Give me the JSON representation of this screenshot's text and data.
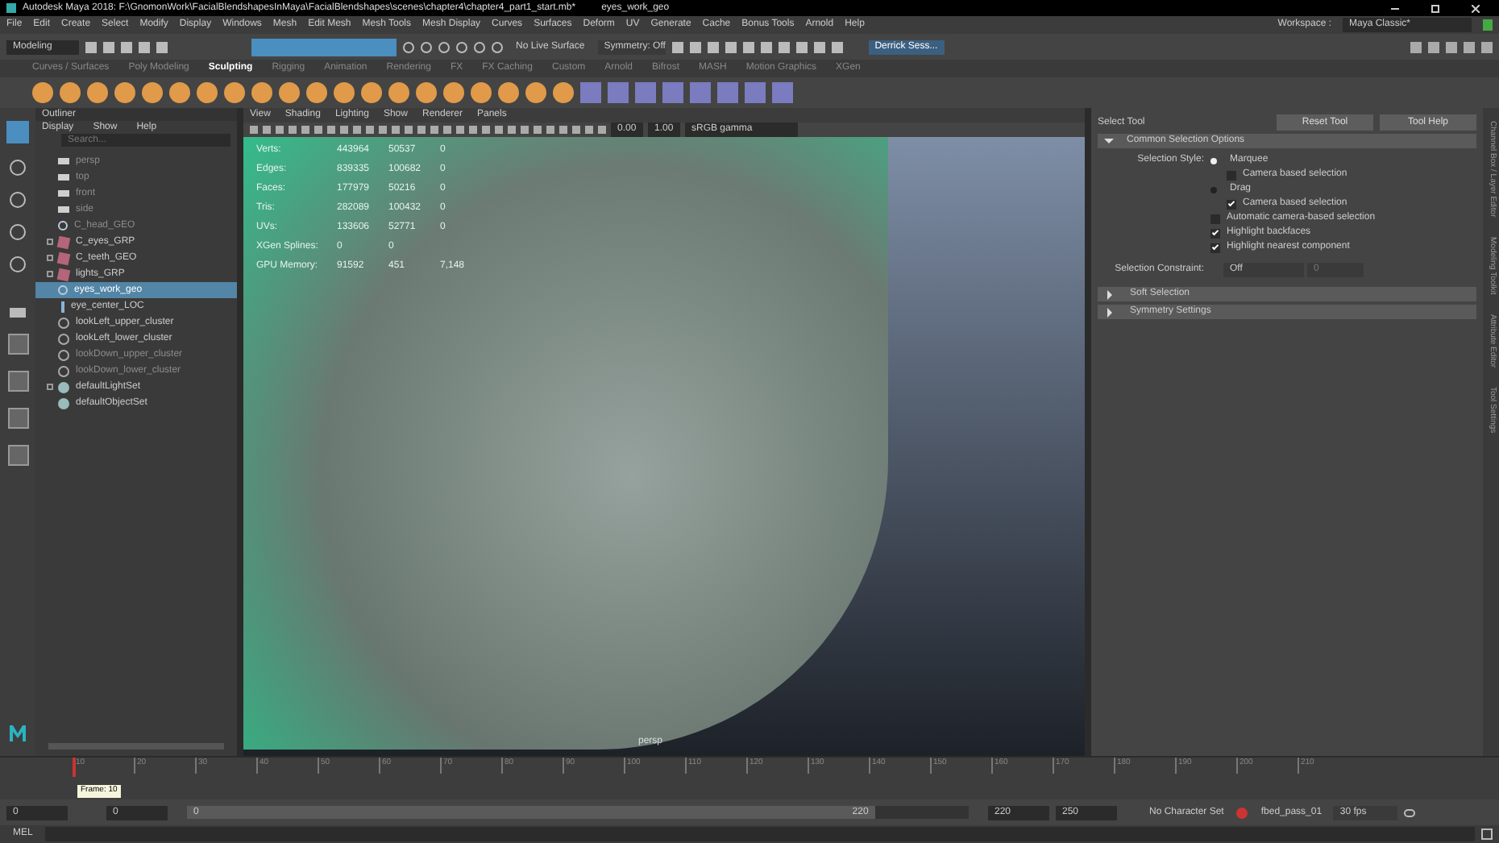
{
  "window": {
    "title": "Autodesk Maya 2018: F:\\GnomonWork\\FacialBlendshapesInMaya\\FacialBlendshapes\\scenes\\chapter4\\chapter4_part1_start.mb*",
    "object": "eyes_work_geo"
  },
  "menu_bar": [
    "File",
    "Edit",
    "Create",
    "Select",
    "Modify",
    "Display",
    "Windows",
    "Mesh",
    "Edit Mesh",
    "Mesh Tools",
    "Mesh Display",
    "Curves",
    "Surfaces",
    "Deform",
    "UV",
    "Generate",
    "Cache",
    "Bonus Tools",
    "Arnold",
    "Help"
  ],
  "status_line": {
    "mode": "Modeling",
    "live_surface": "No Live Surface",
    "symmetry": "Symmetry: Off",
    "user": "Derrick Sess...",
    "workspace_label": "Workspace :",
    "workspace": "Maya Classic*"
  },
  "shelf": {
    "tabs": [
      {
        "label": "Curves / Surfaces",
        "selected": false
      },
      {
        "label": "Poly Modeling",
        "selected": false
      },
      {
        "label": "Sculpting",
        "selected": true
      },
      {
        "label": "Rigging",
        "selected": false
      },
      {
        "label": "Animation",
        "selected": false
      },
      {
        "label": "Rendering",
        "selected": false
      },
      {
        "label": "FX",
        "selected": false
      },
      {
        "label": "FX Caching",
        "selected": false
      },
      {
        "label": "Custom",
        "selected": false
      },
      {
        "label": "Arnold",
        "selected": false
      },
      {
        "label": "Bifrost",
        "selected": false
      },
      {
        "label": "MASH",
        "selected": false
      },
      {
        "label": "Motion Graphics",
        "selected": false
      },
      {
        "label": "XGen",
        "selected": false
      }
    ]
  },
  "outliner": {
    "title": "Outliner",
    "menu": [
      "Display",
      "Show",
      "Help"
    ],
    "search": {
      "placeholder": "Search..."
    },
    "items": [
      {
        "label": "persp",
        "kind": "camera",
        "expandable": false,
        "dimmed": true,
        "selected": false
      },
      {
        "label": "top",
        "kind": "camera",
        "expandable": false,
        "dimmed": true,
        "selected": false
      },
      {
        "label": "front",
        "kind": "camera",
        "expandable": false,
        "dimmed": true,
        "selected": false
      },
      {
        "label": "side",
        "kind": "camera",
        "expandable": false,
        "dimmed": true,
        "selected": false
      },
      {
        "label": "C_head_GEO",
        "kind": "mesh",
        "expandable": false,
        "dimmed": true,
        "selected": false
      },
      {
        "label": "C_eyes_GRP",
        "kind": "group",
        "expandable": true,
        "dimmed": false,
        "selected": false
      },
      {
        "label": "C_teeth_GEO",
        "kind": "group",
        "expandable": true,
        "dimmed": false,
        "selected": false
      },
      {
        "label": "lights_GRP",
        "kind": "group",
        "expandable": true,
        "dimmed": false,
        "selected": false
      },
      {
        "label": "eyes_work_geo",
        "kind": "mesh",
        "expandable": false,
        "dimmed": false,
        "selected": true
      },
      {
        "label": "eye_center_LOC",
        "kind": "locator",
        "expandable": false,
        "dimmed": false,
        "selected": false
      },
      {
        "label": "lookLeft_upper_cluster",
        "kind": "cluster",
        "expandable": false,
        "dimmed": false,
        "selected": false
      },
      {
        "label": "lookLeft_lower_cluster",
        "kind": "cluster",
        "expandable": false,
        "dimmed": false,
        "selected": false
      },
      {
        "label": "lookDown_upper_cluster",
        "kind": "cluster",
        "expandable": false,
        "dimmed": true,
        "selected": false
      },
      {
        "label": "lookDown_lower_cluster",
        "kind": "cluster",
        "expandable": false,
        "dimmed": true,
        "selected": false
      },
      {
        "label": "defaultLightSet",
        "kind": "set",
        "expandable": true,
        "dimmed": false,
        "selected": false
      },
      {
        "label": "defaultObjectSet",
        "kind": "set",
        "expandable": false,
        "dimmed": false,
        "selected": false
      }
    ]
  },
  "viewport": {
    "menu": [
      "View",
      "Shading",
      "Lighting",
      "Show",
      "Renderer",
      "Panels"
    ],
    "fields": [
      "0.00",
      "1.00"
    ],
    "color_space": "sRGB gamma",
    "camera_label": "persp",
    "hud": [
      {
        "label": "Verts:",
        "values": [
          "443964",
          "50537",
          "0"
        ]
      },
      {
        "label": "Edges:",
        "values": [
          "839335",
          "100682",
          "0"
        ]
      },
      {
        "label": "Faces:",
        "values": [
          "177979",
          "50216",
          "0"
        ]
      },
      {
        "label": "Tris:",
        "values": [
          "282089",
          "100432",
          "0"
        ]
      },
      {
        "label": "UVs:",
        "values": [
          "133606",
          "52771",
          "0"
        ]
      },
      {
        "label": "XGen Splines:",
        "values": [
          "0",
          "0"
        ]
      },
      {
        "label": "GPU Memory:",
        "values": [
          "91592",
          "451",
          "7,148"
        ]
      }
    ]
  },
  "tool_settings": {
    "title": "Select Tool",
    "buttons": [
      "Reset Tool",
      "Tool Help"
    ],
    "sections": [
      {
        "label": "Common Selection Options",
        "expanded": true
      },
      {
        "label": "Soft Selection",
        "expanded": false
      },
      {
        "label": "Symmetry Settings",
        "expanded": false
      }
    ],
    "style_label": "Selection Style:",
    "options": [
      {
        "kind": "radio",
        "label": "Marquee",
        "checked": true
      },
      {
        "kind": "sub_checkbox",
        "label": "Camera based selection",
        "checked": false
      },
      {
        "kind": "radio",
        "label": "Drag",
        "checked": false
      },
      {
        "kind": "sub_checkbox",
        "label": "Camera based selection",
        "checked": true
      },
      {
        "kind": "checkbox",
        "label": "Automatic camera-based selection",
        "checked": false
      },
      {
        "kind": "checkbox",
        "label": "Highlight backfaces",
        "checked": true
      },
      {
        "kind": "checkbox",
        "label": "Highlight nearest component",
        "checked": true
      }
    ],
    "constraint": {
      "label": "Selection Constraint:",
      "value": "Off",
      "field": "0"
    },
    "side_tabs": [
      "Channel Box / Layer Editor",
      "Modeling Toolkit",
      "Attribute Editor",
      "Tool Settings"
    ]
  },
  "timeline": {
    "ticks": [
      "10",
      "20",
      "30",
      "40",
      "50",
      "60",
      "70",
      "80",
      "90",
      "100",
      "110",
      "120",
      "130",
      "140",
      "150",
      "160",
      "170",
      "180",
      "190",
      "200",
      "210"
    ],
    "tooltip": "Frame: 10",
    "level": 0.0
  },
  "range": {
    "start": "0",
    "current": "0",
    "slider_start": "0",
    "slider_end": "220",
    "level": 0.88,
    "end": "220",
    "max": "250",
    "character_set": "No Character Set",
    "anim_layer": "fbed_pass_01",
    "fps": "30 fps"
  },
  "command_line": {
    "label": "MEL"
  }
}
